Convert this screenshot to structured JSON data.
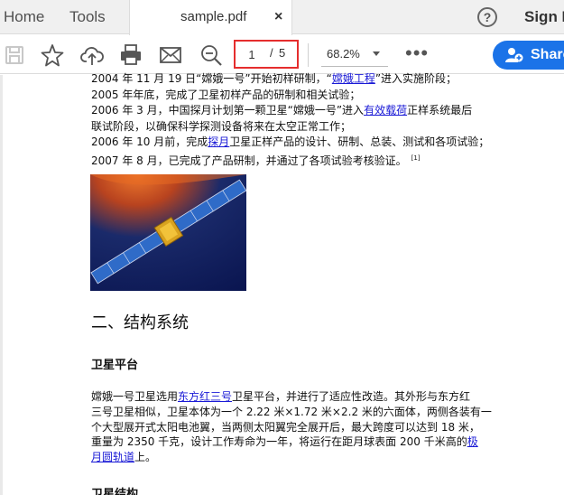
{
  "tabs": {
    "home": "Home",
    "tools": "Tools",
    "document": {
      "title": "sample.pdf",
      "close": "×"
    }
  },
  "header": {
    "help": "?",
    "sign": "Sign I"
  },
  "toolbar": {
    "icons": [
      "save-icon",
      "star-icon",
      "cloud-upload-icon",
      "print-icon",
      "mail-icon",
      "zoom-out-icon"
    ],
    "page_current": "1",
    "page_separator": "/",
    "page_total": "5",
    "zoom": "68.2%",
    "more": "•••",
    "share": "Share"
  },
  "colors": {
    "accent": "#1b73e8",
    "page_box": "#e52d2d",
    "link": "#1a1ad6"
  },
  "document": {
    "lines": [
      {
        "parts": [
          {
            "text": "2004 年 11 月 19 日“嫦娥一号”开始初样研制，“"
          },
          {
            "text": "嫦娥工程",
            "link": true
          },
          {
            "text": "”进入实施阶段；"
          }
        ]
      },
      {
        "parts": [
          {
            "text": "2005 年年底，完成了卫星初样产品的研制和相关试验；"
          }
        ]
      },
      {
        "parts": [
          {
            "text": "2006 年 3 月，中国探月计划第一颗卫星“嫦娥一号”进入"
          },
          {
            "text": "有效载荷",
            "link": true
          },
          {
            "text": "正样系统最后"
          }
        ]
      },
      {
        "parts": [
          {
            "text": "联试阶段，以确保科学探测设备将来在太空正常工作；"
          }
        ]
      },
      {
        "parts": [
          {
            "text": "2006 年 10 月前，完成"
          },
          {
            "text": "探月",
            "link": true
          },
          {
            "text": "卫星正样产品的设计、研制、总装、测试和各项试验；"
          }
        ]
      },
      {
        "parts": [
          {
            "text": "2007 年 8 月，已完成了产品研制，并通过了各项试验考核验证。"
          },
          {
            "text": "[1]",
            "footnote": true
          }
        ]
      }
    ],
    "section_heading": "二、结构系统",
    "sub_heading_1": "卫星平台",
    "platform_lines": [
      {
        "parts": [
          {
            "text": "嫦娥一号卫星选用"
          },
          {
            "text": "东方红三号",
            "link": true
          },
          {
            "text": "卫星平台，并进行了适应性改造。其外形与东方红"
          }
        ]
      },
      {
        "parts": [
          {
            "text": "三号卫星相似，卫星本体为一个 2.22 米×1.72  米×2.2 米的六面体，两侧各装有一"
          }
        ]
      },
      {
        "parts": [
          {
            "text": "个大型展开式太阳电池翼，当两侧太阳翼完全展开后，最大跨度可以达到 18 米，"
          }
        ]
      },
      {
        "parts": [
          {
            "text": "重量为 2350 千克，设计工作寿命为一年，将运行在距月球表面 200 千米高的"
          },
          {
            "text": "极",
            "link": true
          }
        ]
      },
      {
        "parts": [
          {
            "text": "月圆轨道",
            "link": true
          },
          {
            "text": "上。"
          }
        ]
      }
    ],
    "sub_heading_2": "卫星结构"
  }
}
